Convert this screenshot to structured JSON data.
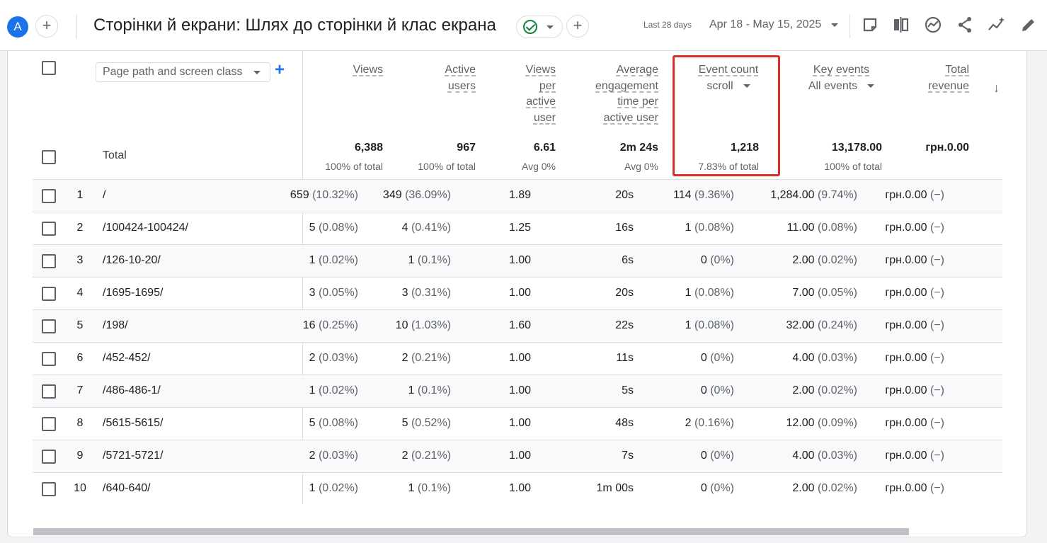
{
  "header": {
    "avatar_letter": "A",
    "title": "Сторінки й екрани: Шлях до сторінки й клас екрана",
    "date_label": "Last 28 days",
    "date_range": "Apr 18 - May 15, 2025",
    "toolbar_icons": [
      "report-icon",
      "compare-icon",
      "insights-icon",
      "share-icon",
      "sparkle-icon",
      "edit-icon"
    ]
  },
  "table": {
    "dimension_select": "Page path and screen class",
    "columns": [
      {
        "name": "views",
        "lines": [
          "Views"
        ],
        "total": "6,388",
        "total_sub": "100% of total"
      },
      {
        "name": "active-users",
        "lines": [
          "Active",
          "users"
        ],
        "total": "967",
        "total_sub": "100% of total"
      },
      {
        "name": "views-per-user",
        "lines": [
          "Views",
          "per",
          "active",
          "user"
        ],
        "total": "6.61",
        "total_sub": "Avg 0%"
      },
      {
        "name": "avg-engagement",
        "lines": [
          "Average",
          "engagement",
          "time per",
          "active user"
        ],
        "total": "2m 24s",
        "total_sub": "Avg 0%"
      },
      {
        "name": "event-count",
        "lines": [
          "Event count"
        ],
        "selector": "scroll",
        "total": "1,218",
        "total_sub": "7.83% of total"
      },
      {
        "name": "key-events",
        "lines": [
          "Key events"
        ],
        "selector": "All events",
        "total": "13,178.00",
        "total_sub": "100% of total"
      },
      {
        "name": "total-revenue",
        "lines": [
          "Total",
          "revenue"
        ],
        "total": "грн.0.00",
        "total_sub": ""
      }
    ],
    "total_label": "Total",
    "rows": [
      {
        "idx": "1",
        "path": "/",
        "cells": [
          [
            "659",
            "(10.32%)"
          ],
          [
            "349",
            "(36.09%)"
          ],
          [
            "1.89",
            ""
          ],
          [
            "20s",
            ""
          ],
          [
            "114",
            "(9.36%)"
          ],
          [
            "1,284.00",
            "(9.74%)"
          ],
          [
            "грн.0.00",
            "(−)"
          ]
        ]
      },
      {
        "idx": "2",
        "path": "/100424-100424/",
        "cells": [
          [
            "5",
            "(0.08%)"
          ],
          [
            "4",
            "(0.41%)"
          ],
          [
            "1.25",
            ""
          ],
          [
            "16s",
            ""
          ],
          [
            "1",
            "(0.08%)"
          ],
          [
            "11.00",
            "(0.08%)"
          ],
          [
            "грн.0.00",
            "(−)"
          ]
        ]
      },
      {
        "idx": "3",
        "path": "/126-10-20/",
        "cells": [
          [
            "1",
            "(0.02%)"
          ],
          [
            "1",
            "(0.1%)"
          ],
          [
            "1.00",
            ""
          ],
          [
            "6s",
            ""
          ],
          [
            "0",
            "(0%)"
          ],
          [
            "2.00",
            "(0.02%)"
          ],
          [
            "грн.0.00",
            "(−)"
          ]
        ]
      },
      {
        "idx": "4",
        "path": "/1695-1695/",
        "cells": [
          [
            "3",
            "(0.05%)"
          ],
          [
            "3",
            "(0.31%)"
          ],
          [
            "1.00",
            ""
          ],
          [
            "20s",
            ""
          ],
          [
            "1",
            "(0.08%)"
          ],
          [
            "7.00",
            "(0.05%)"
          ],
          [
            "грн.0.00",
            "(−)"
          ]
        ]
      },
      {
        "idx": "5",
        "path": "/198/",
        "cells": [
          [
            "16",
            "(0.25%)"
          ],
          [
            "10",
            "(1.03%)"
          ],
          [
            "1.60",
            ""
          ],
          [
            "22s",
            ""
          ],
          [
            "1",
            "(0.08%)"
          ],
          [
            "32.00",
            "(0.24%)"
          ],
          [
            "грн.0.00",
            "(−)"
          ]
        ]
      },
      {
        "idx": "6",
        "path": "/452-452/",
        "cells": [
          [
            "2",
            "(0.03%)"
          ],
          [
            "2",
            "(0.21%)"
          ],
          [
            "1.00",
            ""
          ],
          [
            "11s",
            ""
          ],
          [
            "0",
            "(0%)"
          ],
          [
            "4.00",
            "(0.03%)"
          ],
          [
            "грн.0.00",
            "(−)"
          ]
        ]
      },
      {
        "idx": "7",
        "path": "/486-486-1/",
        "cells": [
          [
            "1",
            "(0.02%)"
          ],
          [
            "1",
            "(0.1%)"
          ],
          [
            "1.00",
            ""
          ],
          [
            "5s",
            ""
          ],
          [
            "0",
            "(0%)"
          ],
          [
            "2.00",
            "(0.02%)"
          ],
          [
            "грн.0.00",
            "(−)"
          ]
        ]
      },
      {
        "idx": "8",
        "path": "/5615-5615/",
        "cells": [
          [
            "5",
            "(0.08%)"
          ],
          [
            "5",
            "(0.52%)"
          ],
          [
            "1.00",
            ""
          ],
          [
            "48s",
            ""
          ],
          [
            "2",
            "(0.16%)"
          ],
          [
            "12.00",
            "(0.09%)"
          ],
          [
            "грн.0.00",
            "(−)"
          ]
        ]
      },
      {
        "idx": "9",
        "path": "/5721-5721/",
        "cells": [
          [
            "2",
            "(0.03%)"
          ],
          [
            "2",
            "(0.21%)"
          ],
          [
            "1.00",
            ""
          ],
          [
            "7s",
            ""
          ],
          [
            "0",
            "(0%)"
          ],
          [
            "4.00",
            "(0.03%)"
          ],
          [
            "грн.0.00",
            "(−)"
          ]
        ]
      },
      {
        "idx": "10",
        "path": "/640-640/",
        "cells": [
          [
            "1",
            "(0.02%)"
          ],
          [
            "1",
            "(0.1%)"
          ],
          [
            "1.00",
            ""
          ],
          [
            "1m 00s",
            ""
          ],
          [
            "0",
            "(0%)"
          ],
          [
            "2.00",
            "(0.02%)"
          ],
          [
            "грн.0.00",
            "(−)"
          ]
        ]
      }
    ]
  },
  "colors": {
    "accent": "#1a73e8",
    "highlight": "#d93025",
    "success": "#188038"
  }
}
